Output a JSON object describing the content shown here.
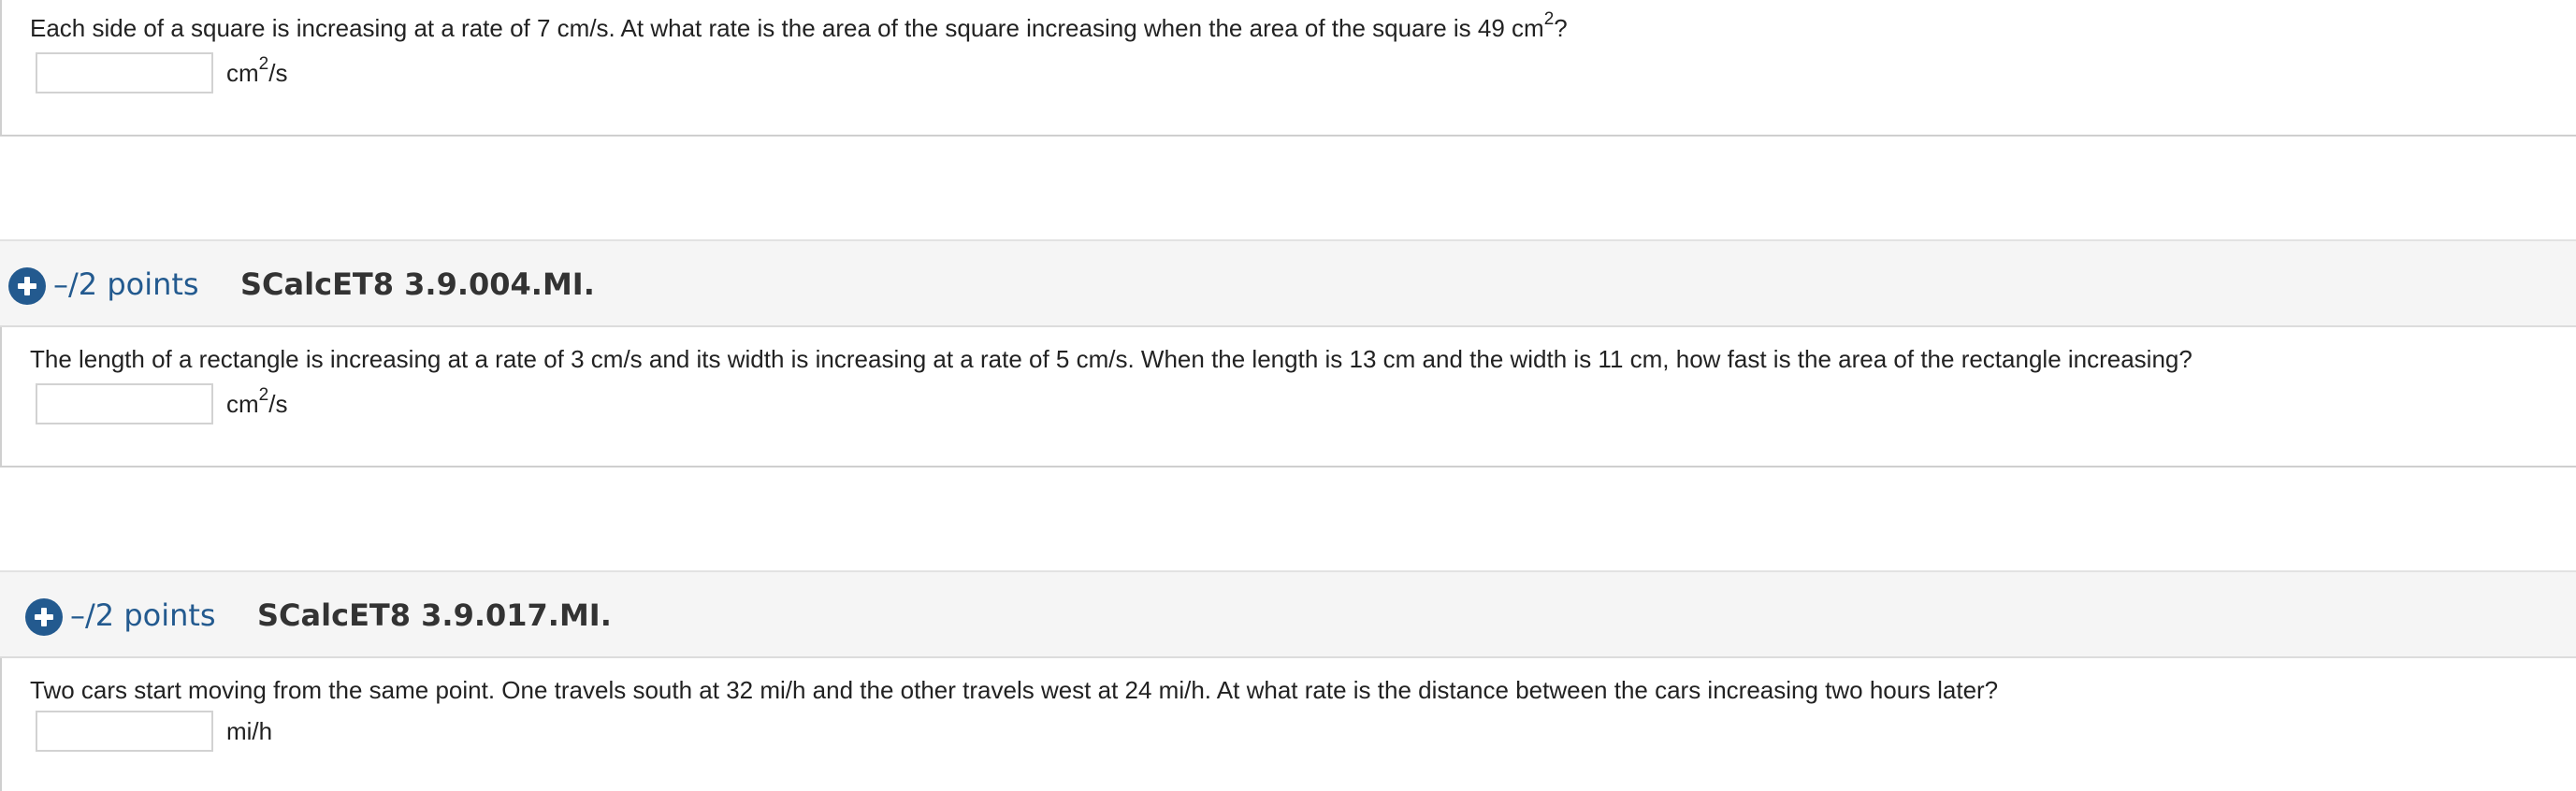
{
  "questions": [
    {
      "text_before": "Each side of a square is increasing at a rate of 7 cm/s. At what rate is the area of the square increasing when the area of the square is 49 cm",
      "text_sup": "2",
      "text_after": "?",
      "answer_value": "",
      "unit_base": "cm",
      "unit_sup": "2",
      "unit_after": "/s"
    },
    {
      "points": "–/2 points",
      "id": "SCalcET8 3.9.004.MI.",
      "text": "The length of a rectangle is increasing at a rate of 3 cm/s and its width is increasing at a rate of 5 cm/s. When the length is 13 cm and the width is 11 cm, how fast is the area of the rectangle increasing?",
      "answer_value": "",
      "unit_base": "cm",
      "unit_sup": "2",
      "unit_after": "/s"
    },
    {
      "points": "–/2 points",
      "id": "SCalcET8 3.9.017.MI.",
      "text": "Two cars start moving from the same point. One travels south at 32 mi/h and the other travels west at 24 mi/h. At what rate is the distance between the cars increasing two hours later?",
      "answer_value": "",
      "unit": "mi/h"
    }
  ],
  "colors": {
    "accent": "#235a8f",
    "header_bg": "#f5f5f5",
    "border": "#cfcfcf",
    "text": "#222222"
  },
  "icons": {
    "expand": "plus-circle-icon"
  }
}
